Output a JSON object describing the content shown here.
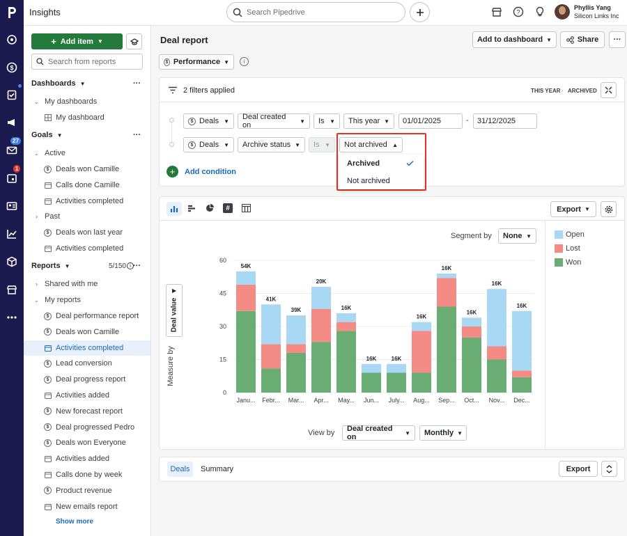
{
  "app": {
    "title": "Insights"
  },
  "search": {
    "placeholder": "Search Pipedrive"
  },
  "user": {
    "name": "Phyllis Yang",
    "company": "Silicon Links Inc"
  },
  "rail": {
    "badges": {
      "mail": "27",
      "calendar": "1"
    }
  },
  "sidebar": {
    "add_item": "Add item",
    "search_placeholder": "Search from reports",
    "dashboards_label": "Dashboards",
    "my_dashboards": "My dashboards",
    "my_dashboard": "My dashboard",
    "goals_label": "Goals",
    "active_label": "Active",
    "goals_active": [
      "Deals won Camille",
      "Calls done Camille",
      "Activities completed"
    ],
    "past_label": "Past",
    "goals_past": [
      "Deals won last year",
      "Activities completed"
    ],
    "reports_label": "Reports",
    "reports_count": "5/150",
    "shared_with_me": "Shared with me",
    "my_reports": "My reports",
    "reports": [
      "Deal performance report",
      "Deals won Camille",
      "Activities completed",
      "Lead conversion",
      "Deal progress report",
      "Activities added",
      "New forecast report",
      "Deal progressed Pedro",
      "Deals won Everyone",
      "Activities added",
      "Calls done by week",
      "Product revenue",
      "New emails report"
    ],
    "show_more": "Show more"
  },
  "report": {
    "title": "Deal report",
    "add_to_dashboard": "Add to dashboard",
    "share": "Share",
    "type": "Performance"
  },
  "filters": {
    "summary": "2 filters applied",
    "tag_period": "THIS YEAR",
    "tag_sep": "·",
    "tag_archived": "ARCHIVED",
    "row1": {
      "entity": "Deals",
      "field": "Deal created on",
      "op": "Is",
      "value": "This year",
      "from": "01/01/2025",
      "dash": "-",
      "to": "31/12/2025"
    },
    "row2": {
      "entity": "Deals",
      "field": "Archive status",
      "op": "Is",
      "value": "Not archived"
    },
    "add_condition": "Add condition",
    "dropdown": {
      "options": [
        "Archived",
        "Not archived"
      ],
      "checked": "Archived"
    }
  },
  "chart_panel": {
    "export": "Export",
    "segment_by_label": "Segment by",
    "segment_by": "None",
    "measure_by_label": "Measure by",
    "measure": "Deal value",
    "view_by_label": "View by",
    "view_by": "Deal created on",
    "interval": "Monthly"
  },
  "bottom": {
    "tabs": [
      "Deals",
      "Summary"
    ],
    "export": "Export"
  },
  "colors": {
    "open": "#a9d8f5",
    "lost": "#f48b84",
    "won": "#6aad74",
    "brand": "#1a1a4e",
    "primary": "#237a3b",
    "link": "#1a6ac0",
    "highlight": "#e8321e"
  },
  "chart_data": {
    "type": "bar",
    "stacked": true,
    "categories": [
      "Janu...",
      "Febr...",
      "Mar...",
      "Apr...",
      "May...",
      "Jun...",
      "July...",
      "Aug...",
      "Sep...",
      "Oct...",
      "Nov...",
      "Dec..."
    ],
    "series": [
      {
        "name": "Won",
        "values": [
          37,
          11,
          18,
          23,
          28,
          9,
          9,
          9,
          39,
          25,
          15,
          7
        ]
      },
      {
        "name": "Lost",
        "values": [
          12,
          11,
          4,
          15,
          4,
          0,
          0,
          19,
          13,
          5,
          6,
          3
        ]
      },
      {
        "name": "Open",
        "values": [
          6,
          18,
          13,
          10,
          4,
          4,
          4,
          4,
          2,
          4,
          26,
          27
        ]
      }
    ],
    "data_labels": [
      "54K",
      "41K",
      "39K",
      "20K",
      "16K",
      "16K",
      "16K",
      "16K",
      "16K",
      "16K",
      "16K",
      "16K"
    ],
    "yticks": [
      0,
      15,
      30,
      45,
      60
    ],
    "ylim": [
      0,
      60
    ],
    "legend": [
      "Open",
      "Lost",
      "Won"
    ],
    "legend_position": "right",
    "grid": true
  }
}
